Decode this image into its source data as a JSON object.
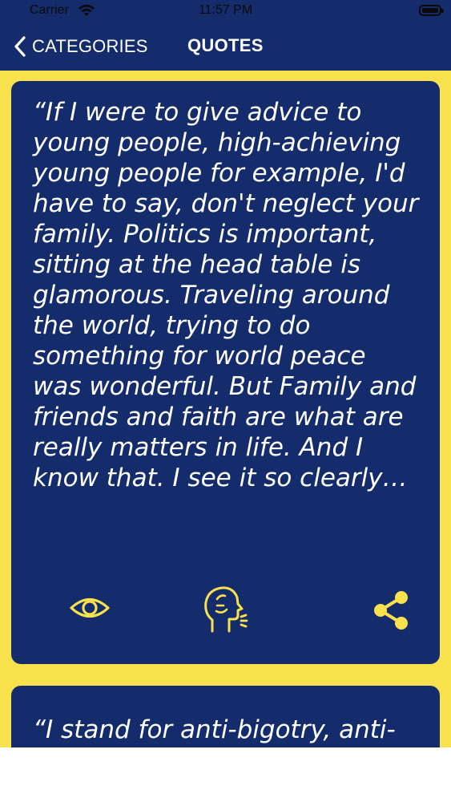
{
  "status_bar": {
    "carrier": "Carrier",
    "time": "11:57 PM"
  },
  "nav": {
    "back_label": "CATEGORIES",
    "title": "QUOTES"
  },
  "quotes": [
    {
      "text": "“If I were to give advice to\nyoung people, high-achieving\nyoung people for example, I'd\nhave to say, don't neglect your\nfamily. Politics is important,\nsitting at the head table is\nglamorous. Traveling around\nthe world, trying to do\nsomething for world peace\nwas wonderful. But Family and\nfriends and faith are what are\nreally matters in life. And I\nknow that. I see it so clearly…"
    },
    {
      "text": "“I stand for anti-bigotry, anti-"
    }
  ],
  "actions": [
    {
      "icon": "eye-icon"
    },
    {
      "icon": "speaking-head-icon"
    },
    {
      "icon": "share-icon"
    }
  ],
  "colors": {
    "navy": "#142c6b",
    "yellow": "#f7e24e",
    "icon_yellow": "#f7e24e",
    "white": "#ffffff"
  }
}
